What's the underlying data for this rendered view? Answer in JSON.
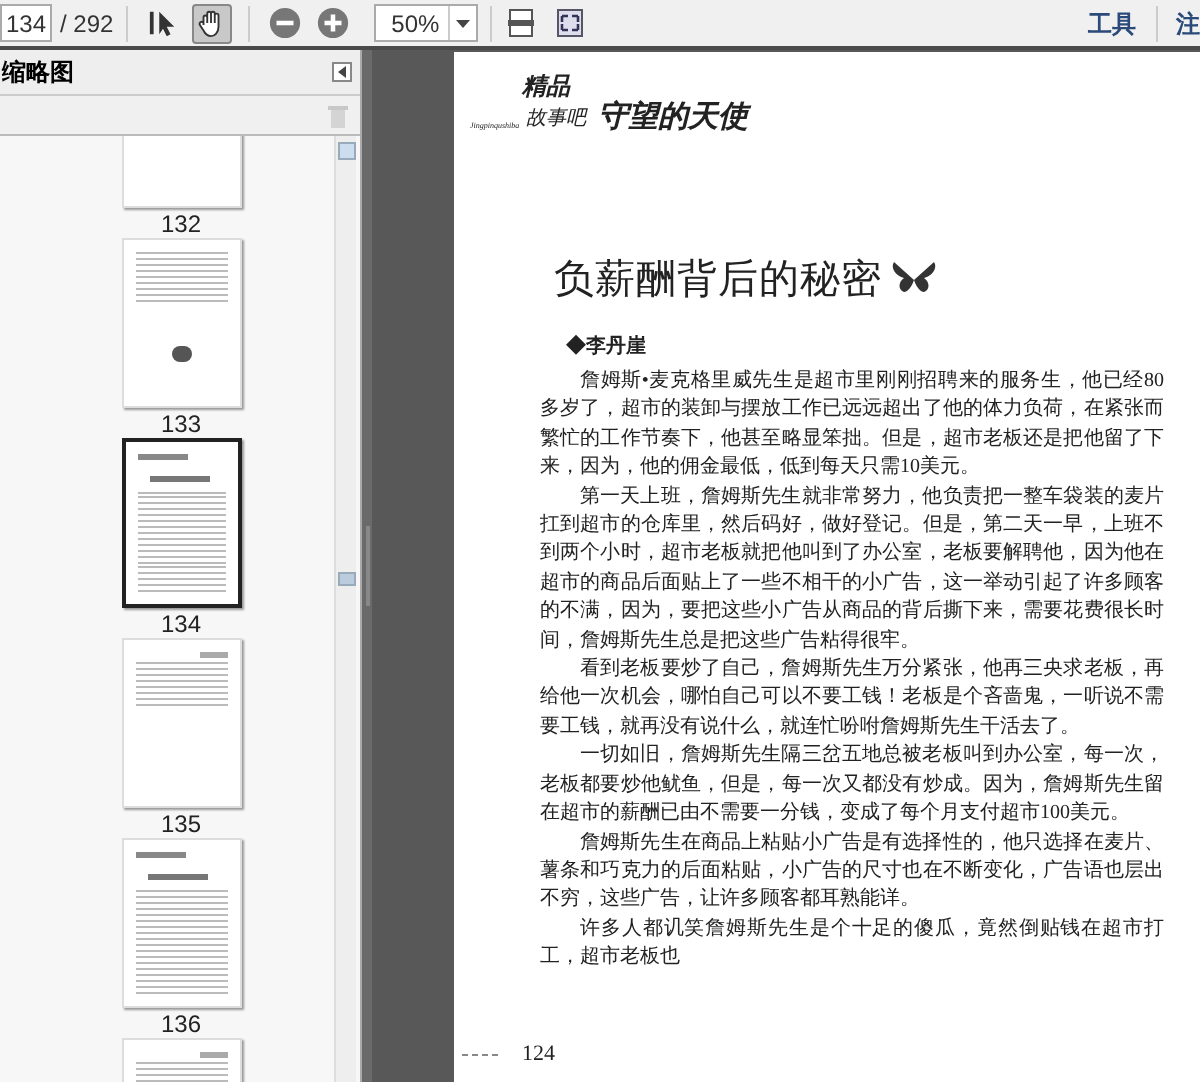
{
  "toolbar": {
    "page_input": "134",
    "page_total": "/ 292",
    "tools": [
      {
        "kind": "select",
        "selected": false
      },
      {
        "kind": "hand",
        "selected": true
      }
    ],
    "zoom": "50%",
    "links": [
      "工具",
      "注"
    ]
  },
  "sidebar": {
    "title": "缩略图",
    "thumbnails": [
      {
        "kind": "text",
        "label": "132",
        "selected": false
      },
      {
        "kind": "picture",
        "label": "133",
        "selected": false
      },
      {
        "kind": "title",
        "label": "134",
        "selected": true
      },
      {
        "kind": "text",
        "label": "135",
        "selected": false
      },
      {
        "kind": "title",
        "label": "136",
        "selected": false
      },
      {
        "kind": "text",
        "selected": false
      }
    ]
  },
  "document": {
    "logo_top": "精品",
    "logo_bottom": "故事吧",
    "logo_pinyin": "Jingpinqushiba",
    "section": "守望的天使",
    "title": "负薪酬背后的秘密",
    "author": "◆李丹崖",
    "paragraphs": [
      "詹姆斯•麦克格里威先生是超市里刚刚招聘来的服务生，他已经80多岁了，超市的装卸与摆放工作已远远超出了他的体力负荷，在紧张而繁忙的工作节奏下，他甚至略显笨拙。但是，超市老板还是把他留了下来，因为，他的佣金最低，低到每天只需10美元。",
      "第一天上班，詹姆斯先生就非常努力，他负责把一整车袋装的麦片扛到超市的仓库里，然后码好，做好登记。但是，第二天一早，上班不到两个小时，超市老板就把他叫到了办公室，老板要解聘他，因为他在超市的商品后面贴上了一些不相干的小广告，这一举动引起了许多顾客的不满，因为，要把这些小广告从商品的背后撕下来，需要花费很长时间，詹姆斯先生总是把这些广告粘得很牢。",
      "看到老板要炒了自己，詹姆斯先生万分紧张，他再三央求老板，再给他一次机会，哪怕自己可以不要工钱！老板是个吝啬鬼，一听说不需要工钱，就再没有说什么，就连忙吩咐詹姆斯先生干活去了。",
      "一切如旧，詹姆斯先生隔三岔五地总被老板叫到办公室，每一次，老板都要炒他鱿鱼，但是，每一次又都没有炒成。因为，詹姆斯先生留在超市的薪酬已由不需要一分钱，变成了每个月支付超市100美元。",
      "詹姆斯先生在商品上粘贴小广告是有选择性的，他只选择在麦片、薯条和巧克力的后面粘贴，小广告的尺寸也在不断变化，广告语也层出不穷，这些广告，让许多顾客都耳熟能详。",
      "许多人都讥笑詹姆斯先生是个十足的傻瓜，竟然倒贴钱在超市打工，超市老板也"
    ],
    "page_number": "124"
  }
}
